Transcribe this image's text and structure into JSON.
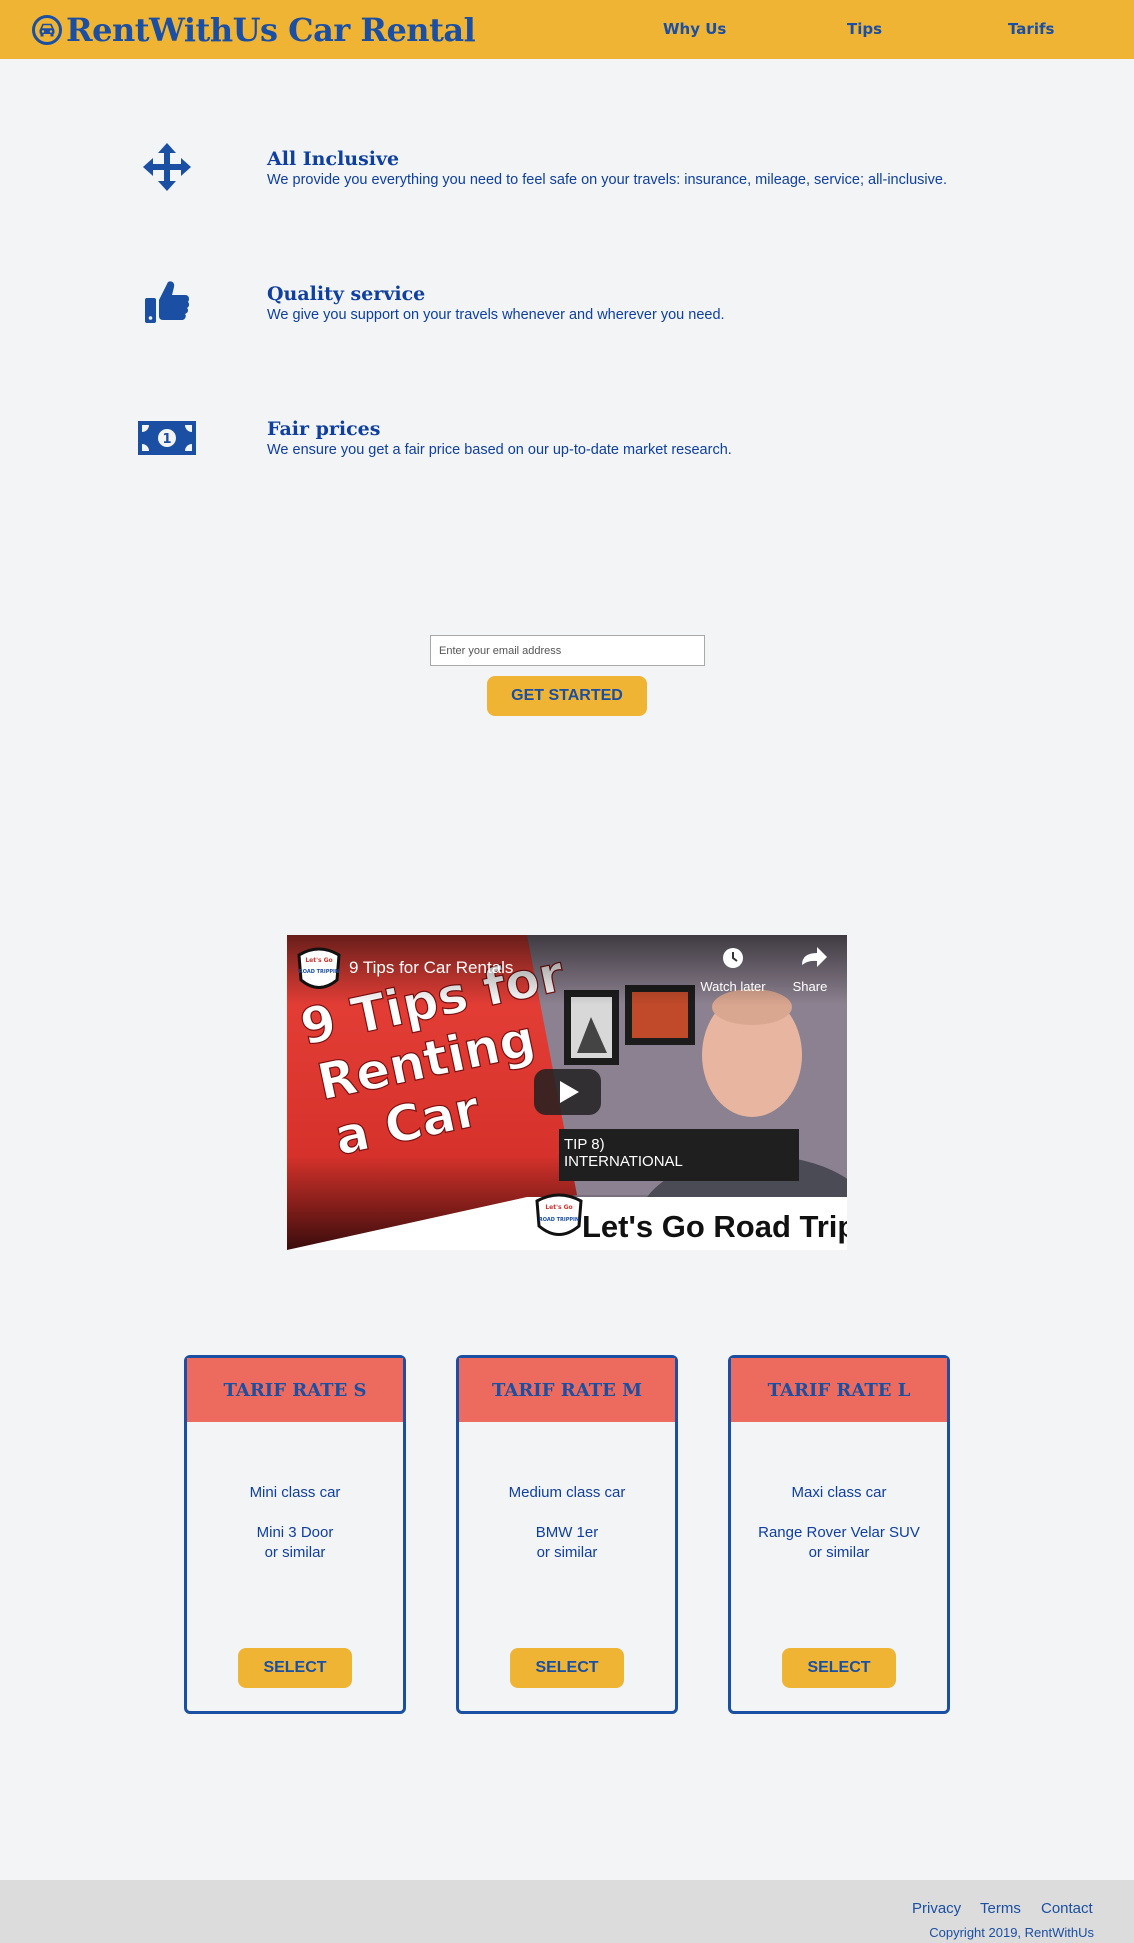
{
  "header": {
    "logo_text": "RentWithUs Car Rental",
    "nav": [
      "Why Us",
      "Tips",
      "Tarifs"
    ]
  },
  "features": [
    {
      "icon": "arrows-move-icon",
      "title": "All Inclusive",
      "desc": "We provide you everything you need to feel safe on your travels: insurance, mileage, service; all-inclusive."
    },
    {
      "icon": "thumbs-up-icon",
      "title": "Quality service",
      "desc": "We give you support on your travels whenever and wherever you need."
    },
    {
      "icon": "money-bill-icon",
      "title": "Fair prices",
      "desc": "We ensure you get a fair price based on our up-to-date market research."
    }
  ],
  "form": {
    "email_placeholder": "Enter your email address",
    "submit_label": "GET STARTED"
  },
  "video": {
    "title": "9 Tips for Car Rentals",
    "watch_later": "Watch later",
    "share": "Share",
    "thumb_lines": [
      "9 Tips for",
      "Renting",
      "a Car"
    ],
    "overlay_line1": "TIP 8)",
    "overlay_line2": "INTERNATIONAL",
    "brand": "Let's Go Road Trippin",
    "badge_top": "Let's Go",
    "badge_bottom": "ROAD TRIPPIN"
  },
  "tarifs": [
    {
      "title": "TARIF RATE S",
      "class": "Mini class car",
      "model": "Mini 3 Door",
      "similar": "or similar",
      "button": "SELECT"
    },
    {
      "title": "TARIF RATE M",
      "class": "Medium class car",
      "model": "BMW 1er",
      "similar": "or similar",
      "button": "SELECT"
    },
    {
      "title": "TARIF RATE L",
      "class": "Maxi class car",
      "model": "Range Rover Velar SUV",
      "similar": "or similar",
      "button": "SELECT"
    }
  ],
  "footer": {
    "links": [
      "Privacy",
      "Terms",
      "Contact"
    ],
    "copyright": "Copyright 2019, RentWithUs"
  },
  "colors": {
    "accent": "#f0b435",
    "brand_blue": "#1a4fa3",
    "card_head": "#ec6b5e",
    "background": "#f2f4f5",
    "footer_bg": "#dcdcdc"
  }
}
